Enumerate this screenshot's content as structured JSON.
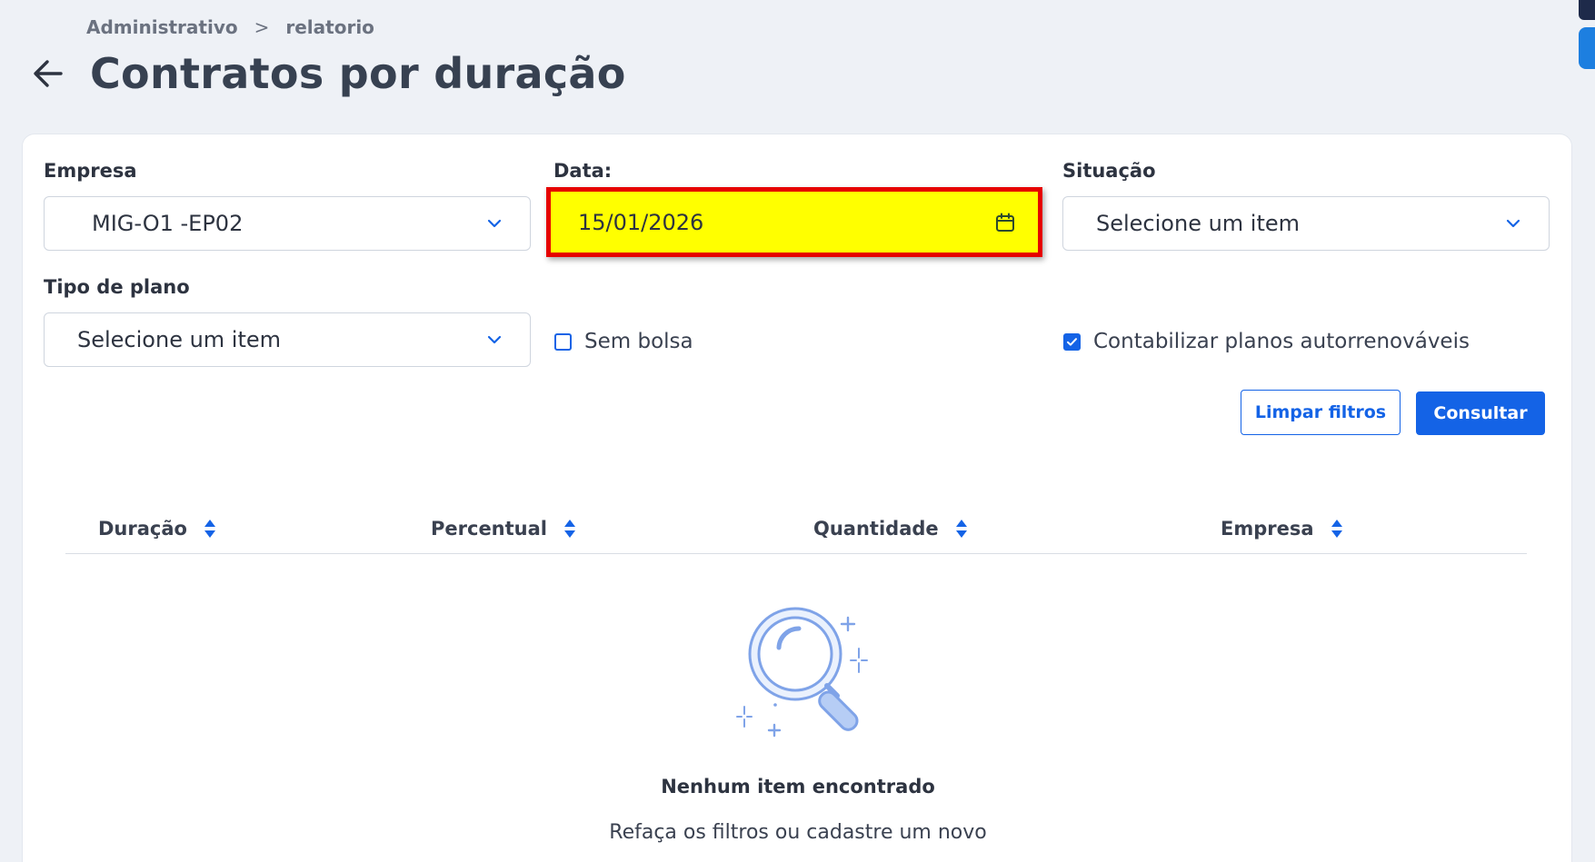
{
  "breadcrumb": {
    "items": [
      "Administrativo",
      "relatorio"
    ],
    "separator": ">"
  },
  "page_title": "Contratos por duração",
  "filters": {
    "empresa": {
      "label": "Empresa",
      "value": "MIG-O1 -EP02"
    },
    "data": {
      "label": "Data:",
      "value": "15/01/2026"
    },
    "situacao": {
      "label": "Situação",
      "value": "Selecione um item"
    },
    "tipo_plano": {
      "label": "Tipo de plano",
      "value": "Selecione um item"
    },
    "sem_bolsa": {
      "label": "Sem bolsa",
      "checked": false
    },
    "autorrenovaveis": {
      "label": "Contabilizar planos autorrenováveis",
      "checked": true
    }
  },
  "actions": {
    "clear_label": "Limpar filtros",
    "submit_label": "Consultar"
  },
  "table": {
    "columns": [
      "Duração",
      "Percentual",
      "Quantidade",
      "Empresa"
    ]
  },
  "empty_state": {
    "title": "Nenhum item encontrado",
    "subtitle": "Refaça os filtros ou cadastre um novo"
  },
  "colors": {
    "primary": "#1463e6",
    "highlight_fill": "#ffff00",
    "highlight_border": "#e60000",
    "background": "#eef1f6"
  },
  "icons": {
    "back": "arrow-left-icon",
    "chevron": "chevron-down-icon",
    "calendar": "calendar-icon",
    "sort": "sort-icon",
    "empty": "magnifier-icon"
  }
}
